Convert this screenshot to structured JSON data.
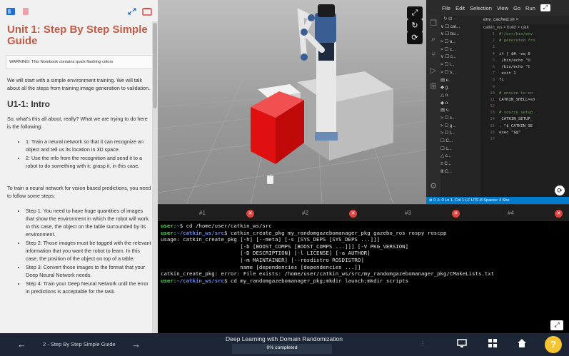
{
  "notebook": {
    "title": "Unit 1: Step By Step Simple Guide",
    "warning": "WARNING: This Notebook contains quick flashing colors",
    "intro_paragraph": "We will start with a simple environment training. We will talk about all the steps from training image generation to validation.",
    "section_heading": "U1-1: Intro",
    "question_paragraph": "So, what's this all about, really? What we are trying to do here is the following:",
    "goals": [
      "1: Train a neural network so that it can recognize an object and tell us its location in 3D space.",
      "2: Use the info from the recognition and send it to a robot to do something with it; grasp it, in this case."
    ],
    "steps_intro": "To train a neural network for vision based predictions, you need to follow some steps:",
    "steps": [
      "Step 1: You need to have huge quantities of images that show the environment in which the robot will work. In this case, the object on the table surrounded by its environment.",
      "Step 2: Those images must be tagged with the relevant information that you want the robot to learn. In this case, the position of the object on top of a table.",
      "Step 3: Convert those images to the format that your Deep Neural Network needs.",
      "Step 4: Train your Deep Neural Network until the error in predictions is acceptable for the task."
    ]
  },
  "editor": {
    "menu": [
      "File",
      "Edit",
      "Selection",
      "View",
      "Go",
      "Run"
    ],
    "tab_name": "env_cached.sh",
    "breadcrumb": "catkin_ws > build > catk",
    "explorer_rows": [
      "∨ ☐ cat...",
      "  ∨ ☐ bu...",
      "    > ☐ a...",
      "    > ☐ c...",
      "    ∨ ☐ c...",
      "      > ☐ i...",
      "      > ☐ s...",
      "        ▤ e.",
      "        ◆ g.",
      "        △ o.",
      "        ◆ o.",
      "        ▤ s.",
      "    > ☐ c...",
      "    > ☐ g...",
      "    > ☐ t...",
      "      ☐ C...",
      "      ☐ c...",
      "      △ c...",
      "      ≡ C...",
      "      Ⅲ C..."
    ],
    "code_lines": [
      {
        "n": "1",
        "t": "#!/usr/bin/env"
      },
      {
        "n": "2",
        "t": "# generated fro"
      },
      {
        "n": "3",
        "t": ""
      },
      {
        "n": "4",
        "t": "if [ $# -eq 0"
      },
      {
        "n": "5",
        "t": "  /bin/echo \"U"
      },
      {
        "n": "6",
        "t": "  /bin/echo \"C"
      },
      {
        "n": "7",
        "t": "  exit 1"
      },
      {
        "n": "8",
        "t": "fi"
      },
      {
        "n": "9",
        "t": ""
      },
      {
        "n": "10",
        "t": "# ensure to no"
      },
      {
        "n": "11",
        "t": "CATKIN_SHELL=sh"
      },
      {
        "n": "12",
        "t": ""
      },
      {
        "n": "13",
        "t": "# source setup"
      },
      {
        "n": "14",
        "t": "_CATKIN_SETUP_"
      },
      {
        "n": "15",
        "t": ". \"$_CATKIN_SE"
      },
      {
        "n": "16",
        "t": "exec \"$@\""
      },
      {
        "n": "17",
        "t": ""
      }
    ],
    "status": "⊗ 0 ⚠ 0   Ln 1, Col 1   LF  UTF-8  Spaces: 4  She"
  },
  "terminal": {
    "tabs": [
      "#1",
      "#2",
      "#3",
      "#4"
    ],
    "lines": [
      {
        "user": "user:",
        "path": "~",
        "cmd": "$ cd /home/user/catkin_ws/src"
      },
      {
        "user": "user:",
        "path": "~/catkin_ws/src",
        "cmd": "$ catkin_create_pkg my_randomgazebomanager_pkg gazebo_ros rospy roscpp"
      },
      {
        "text": "usage: catkin_create_pkg [-h] [--meta] [-s [SYS_DEPS [SYS_DEPS ...]]]"
      },
      {
        "text": "                         [-b [BOOST_COMPS [BOOST_COMPS ...]]] [-V PKG_VERSION]"
      },
      {
        "text": "                         [-D DESCRIPTION] [-l LICENSE] [-a AUTHOR]"
      },
      {
        "text": "                         [-m MAINTAINER] [--rosdistro ROSDISTRO]"
      },
      {
        "text": "                         name [dependencies [dependencies ...]]"
      },
      {
        "text": "catkin_create_pkg: error: File exists: /home/user/catkin_ws/src/my_randomgazebomanager_pkg/CMakeLists.txt"
      },
      {
        "user": "user:",
        "path": "~/catkin_ws/src",
        "cmd": "$ cd my_randomgazebomanager_pkg;mkdir launch;mkdir scripts"
      }
    ]
  },
  "bottombar": {
    "prev_label": "←",
    "unit_label": "2 - Step By Step Simple Guide",
    "next_label": "→",
    "course_title": "Deep Learning with Domain Randomization",
    "progress_text": "0% completed",
    "progress_value": 0,
    "help_label": "?"
  },
  "colors": {
    "title": "#c25b45",
    "term_user": "#5fd35f",
    "term_path": "#6b8df0",
    "status_bar": "#007acc",
    "help": "#f6c531",
    "cube": "#e01010"
  }
}
